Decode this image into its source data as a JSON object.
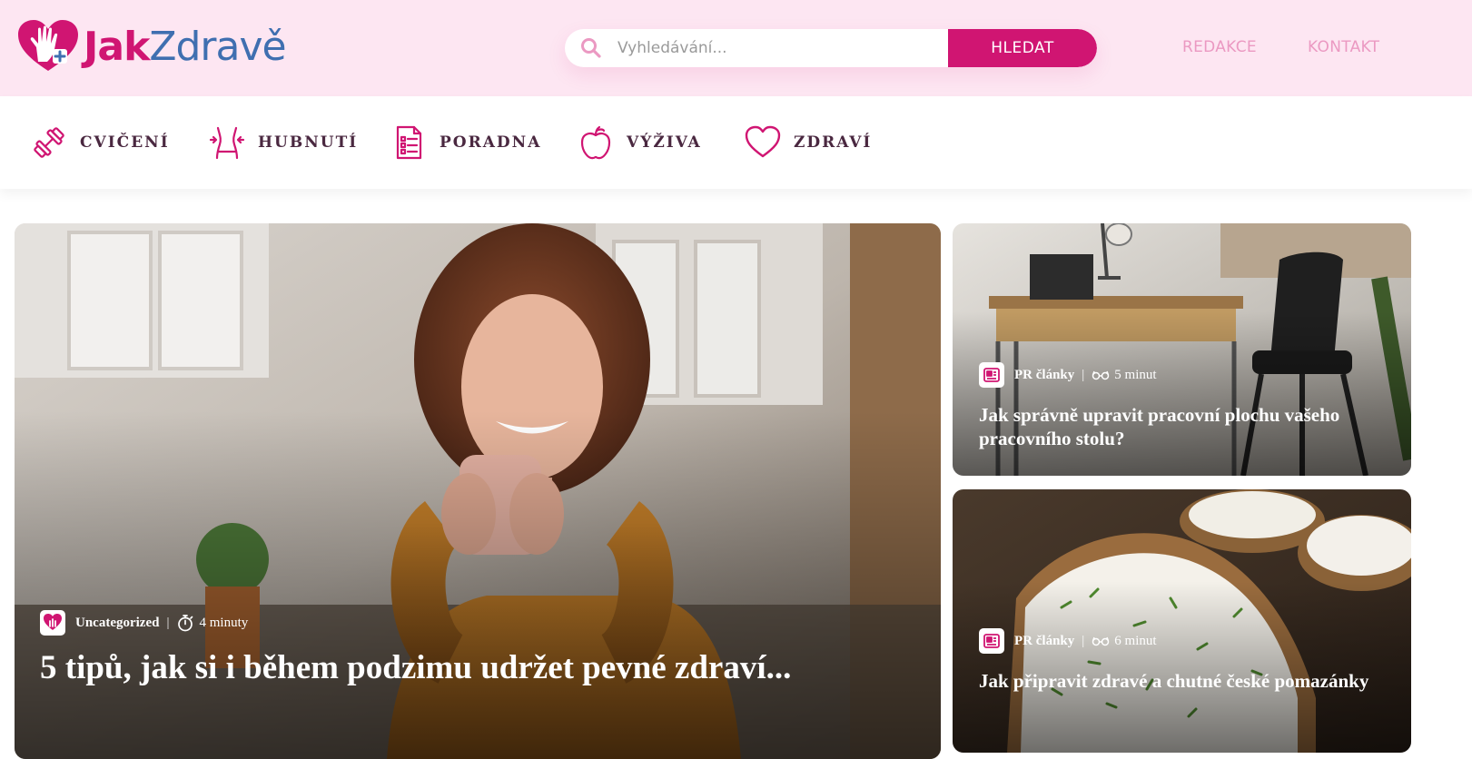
{
  "header": {
    "logo_part1": "Jak",
    "logo_part2": "Zdravě",
    "search_placeholder": "Vyhledávání...",
    "search_button": "HLEDAT",
    "links": [
      "REDAKCE",
      "KONTAKT"
    ]
  },
  "categories": [
    {
      "label": "CVIČENÍ",
      "icon": "dumbbell-icon"
    },
    {
      "label": "HUBNUTÍ",
      "icon": "waist-icon"
    },
    {
      "label": "PORADNA",
      "icon": "document-icon"
    },
    {
      "label": "VÝŽIVA",
      "icon": "apple-icon"
    },
    {
      "label": "ZDRAVÍ",
      "icon": "heart-icon"
    }
  ],
  "featured": {
    "category": "Uncategorized",
    "read_time": "4 minuty",
    "title": "5 tipů, jak si i během podzimu udržet pevné zdraví..."
  },
  "side_articles": [
    {
      "category": "PR články",
      "read_time": "5 minut",
      "title": "Jak správně upravit pracovní plochu vašeho pracovního stolu?"
    },
    {
      "category": "PR články",
      "read_time": "6 minut",
      "title": "Jak připravit zdravé a chutné české pomazánky"
    }
  ],
  "colors": {
    "brand": "#d01572",
    "brand_blue": "#3f6fb0",
    "header_bg": "#fde6f2",
    "link": "#eb99c2"
  }
}
